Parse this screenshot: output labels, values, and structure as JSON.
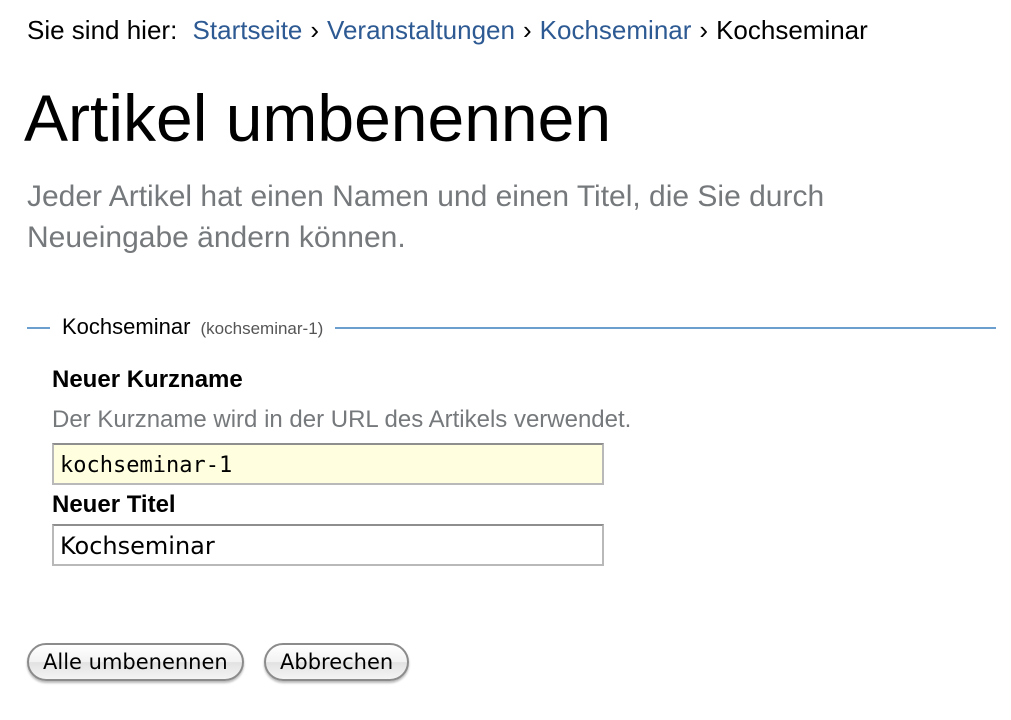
{
  "breadcrumb": {
    "prefix": "Sie sind hier:",
    "items": [
      "Startseite",
      "Veranstaltungen",
      "Kochseminar"
    ],
    "current": "Kochseminar",
    "separator": "›"
  },
  "page": {
    "title": "Artikel umbenennen",
    "description": "Jeder Artikel hat einen Namen und einen Titel, die Sie durch Neueingabe ändern können."
  },
  "item": {
    "title": "Kochseminar",
    "id": "(kochseminar-1)",
    "shortname": {
      "label": "Neuer Kurzname",
      "help": "Der Kurzname wird in der URL des Artikels verwendet.",
      "value": "kochseminar-1"
    },
    "title_field": {
      "label": "Neuer Titel",
      "value": "Kochseminar"
    }
  },
  "buttons": {
    "rename_all": "Alle umbenennen",
    "cancel": "Abbrechen"
  },
  "colors": {
    "link": "#2d5a93",
    "fieldset_border": "#6a9fd0",
    "description_text": "#76797c",
    "input_highlight": "#ffffdf"
  }
}
